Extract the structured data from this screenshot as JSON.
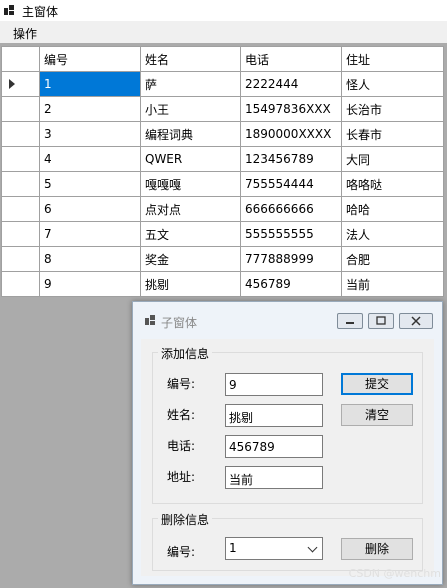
{
  "main_window": {
    "title": "主窗体"
  },
  "menu": {
    "items": [
      "操作"
    ]
  },
  "grid": {
    "columns": [
      "编号",
      "姓名",
      "电话",
      "住址"
    ],
    "rows": [
      [
        "1",
        "萨",
        "2222444",
        "怪人"
      ],
      [
        "2",
        "小王",
        "15497836XXX",
        "长治市"
      ],
      [
        "3",
        "编程词典",
        "1890000XXXX",
        "长春市"
      ],
      [
        "4",
        "QWER",
        "123456789",
        "大同"
      ],
      [
        "5",
        "嘎嘎嘎",
        "755554444",
        "咯咯哒"
      ],
      [
        "6",
        "点对点",
        "666666666",
        "哈哈"
      ],
      [
        "7",
        "五文",
        "555555555",
        "法人"
      ],
      [
        "8",
        "奖金",
        "777888999",
        "合肥"
      ],
      [
        "9",
        "挑剔",
        "456789",
        "当前"
      ]
    ],
    "selected_row": 0
  },
  "sub_window": {
    "title": "子窗体",
    "add_group": {
      "label": "添加信息",
      "id_label": "编号:",
      "id_value": "9",
      "name_label": "姓名:",
      "name_value": "挑剔",
      "phone_label": "电话:",
      "phone_value": "456789",
      "address_label": "地址:",
      "address_value": "当前",
      "submit_label": "提交",
      "clear_label": "清空"
    },
    "delete_group": {
      "label": "删除信息",
      "id_label": "编号:",
      "selected_id": "1",
      "delete_label": "删除"
    }
  },
  "watermark": "CSDN @wenchm"
}
